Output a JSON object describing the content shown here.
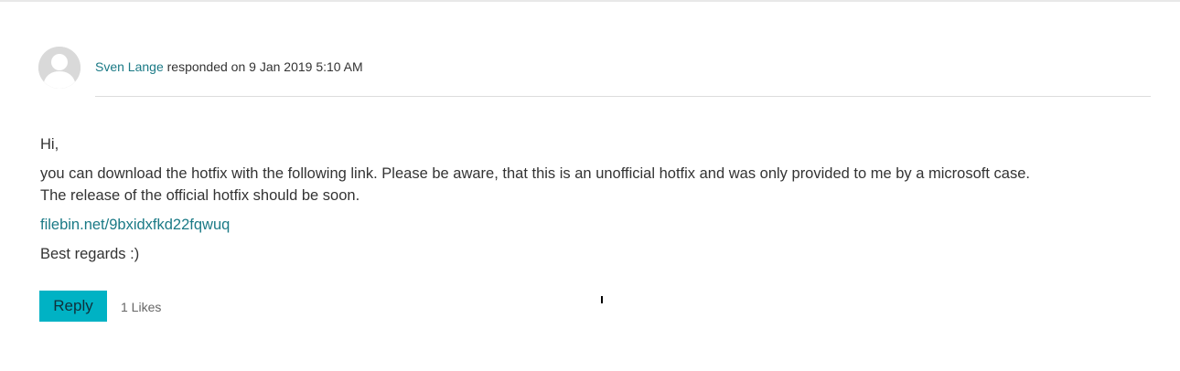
{
  "post": {
    "author": "Sven Lange",
    "action_text": " responded on 9 Jan 2019 5:10 AM",
    "avatar_icon": "user-icon",
    "body": {
      "greeting": "Hi,",
      "main_line1": "you can download the hotfix with the following link. Please be aware, that this is an unofficial hotfix and was only provided to me by a microsoft case.",
      "main_line2": "The release of the official hotfix should be soon.",
      "link_text": "filebin.net/9bxidxfkd22fqwuq",
      "closing": "Best regards :)"
    },
    "actions": {
      "reply_label": "Reply",
      "likes_text": "1 Likes"
    }
  },
  "colors": {
    "link": "#1b7a86",
    "reply_button": "#00b2c4",
    "text": "#333333",
    "muted": "#666666"
  }
}
